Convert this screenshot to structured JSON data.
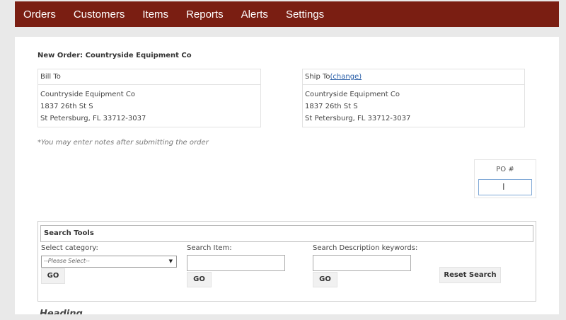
{
  "nav": {
    "items": [
      "Orders",
      "Customers",
      "Items",
      "Reports",
      "Alerts",
      "Settings"
    ]
  },
  "order": {
    "title": "New Order: Countryside Equipment Co"
  },
  "bill_to": {
    "heading": "Bill To",
    "lines": [
      "Countryside Equipment Co",
      "1837 26th St S",
      "St Petersburg, FL 33712-3037"
    ]
  },
  "ship_to": {
    "heading": "Ship To",
    "change_link": "(change)",
    "lines": [
      "Countryside Equipment Co",
      "1837 26th St S",
      "St Petersburg, FL 33712-3037"
    ]
  },
  "notes": {
    "text": "*You may enter notes after submitting the order"
  },
  "po": {
    "label": "PO #",
    "value": "",
    "cursor_icon": "text-cursor-icon"
  },
  "search": {
    "title": "Search Tools",
    "category_label": "Select category:",
    "category_selected": "--Please Select--",
    "item_label": "Search Item:",
    "item_value": "",
    "desc_label": "Search Description keywords:",
    "desc_value": "",
    "go_label": "GO",
    "reset_label": "Reset Search"
  },
  "section_below": {
    "heading": "Heading"
  },
  "colors": {
    "nav_bg": "#7a1e12",
    "link": "#2a5fa8",
    "input_focus_border": "#7fa8d6"
  }
}
